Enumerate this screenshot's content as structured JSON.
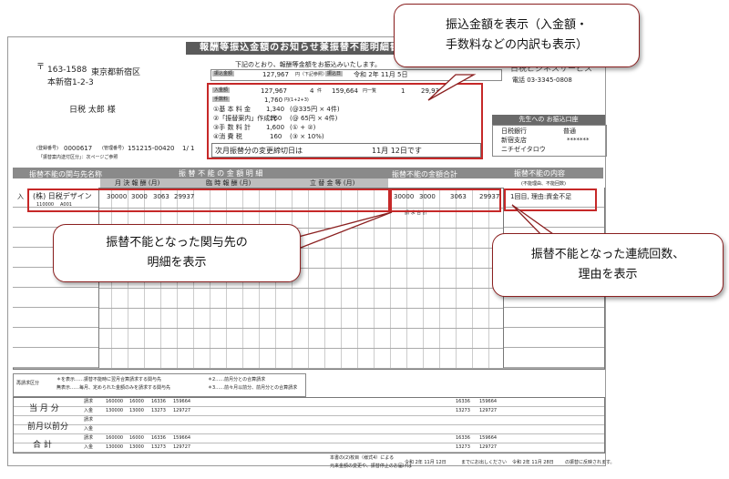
{
  "header": {
    "title": "報酬等振込金額のお知らせ兼振替不能明細書",
    "notice": "下記のとおり、報酬等金額をお振込みいたします。",
    "postal": "〒",
    "zip": "163-1588",
    "address1": "東京都新宿区",
    "address2": "本新宿1-2-3",
    "recipient": "日税 太郎 様",
    "sender": "日税ビジネスサービス",
    "phone": "電話 03-3345-0808"
  },
  "amounts": {
    "transfer_label": "振込金額",
    "transfer_value": "127,967",
    "transfer_unit": "円（下記参照）",
    "date_label": "振込日",
    "date_value": "令和 2年 11月 5日",
    "deposit_label": "入金額",
    "deposit_value": "127,967",
    "deposit_count": "4",
    "deposit_count_unit": "件",
    "deposit_total": "159,664",
    "deposit_total_unit": "円一覧",
    "fail_count": "1",
    "fail_amount": "29,937",
    "fee_label": "手数料",
    "fee_value": "1,760",
    "fee_formula": "円(1+2+3)",
    "basic_label": "①基 本 料 金",
    "basic_value": "1,340",
    "basic_note": "(@335円 × 4件)",
    "detail_label": "②「振替案内」作成代",
    "detail_value": "260",
    "detail_note": "(@ 65円 × 4件)",
    "proc_label": "③手 数 料 計",
    "proc_value": "1,600",
    "proc_note": "(① + ②)",
    "tax_label": "④消 費 税",
    "tax_value": "160",
    "tax_note": "(③ × 10%)",
    "next_label": "次月振替分の変更締切日は",
    "next_date": "11月 12日です"
  },
  "bank": {
    "title": "先生への お振込口座",
    "bank_name": "日税銀行",
    "branch_name": "新宿支店",
    "account_type": "普通",
    "account_no": "*******",
    "holder": "ニチゼイタロウ"
  },
  "record": {
    "label": "(登録番号)",
    "number": "0000617",
    "manage_label": "(管理番号)",
    "manage_number": "151215-00420",
    "page": "1/ 1",
    "guide": "「振替案内送付区分」：次ページご参照"
  },
  "table": {
    "section_left": "振替不能の関与先名称",
    "section_mid": "振 替 不 能 の 金 額 明 細",
    "section_total": "振替不能の金額合計",
    "section_reason": "振替不能の内容",
    "reason_sub": "(不能理由、不能回数)",
    "col_monthly": "月 決 報 酬 (月)",
    "col_temp": "臨 時 報 酬 (月)",
    "col_advance": "立 替 金 等 (月)",
    "row_mark": "入",
    "row_name": "(株) 日税デザイン",
    "row_code": "110000",
    "row_code2": "A001",
    "row_values": [
      "30000",
      "3000",
      "3063",
      "29937"
    ],
    "row_totals": [
      "30000",
      "3000",
      "3063",
      "29937"
    ],
    "row_reason": "1回目, 理由:資金不足",
    "billing_label": "請 求 合 計"
  },
  "summary": {
    "legend_title": "再請求区分",
    "legend1": "＊を表示……振替不能時に翌月合算請求する関与先",
    "legend2": "無表示……毎月、定められた金額のみを請求する関与先",
    "legend3": "＊2……前月分との合算請求",
    "legend4": "＊3……前々月以前分、前月分との合算請求",
    "current": "当 月 分",
    "previous": "前月以前分",
    "total": "合 計",
    "bill": "請求",
    "deposit": "入金",
    "cur_bill": [
      "160000",
      "16000",
      "16336",
      "159664",
      "16336",
      "159664"
    ],
    "cur_dep": [
      "130000",
      "13000",
      "13273",
      "129727",
      "13273",
      "129727"
    ],
    "tot_bill": [
      "160000",
      "16000",
      "16336",
      "159664",
      "16336",
      "159664"
    ],
    "tot_dep": [
      "130000",
      "13000",
      "13273",
      "129727",
      "13273",
      "129727"
    ],
    "footer_note1": "本書の(2)枚目（様式4）による",
    "footer_note2": "元来金額の変更や、振替停止のお届けは",
    "footer_date1": "令和 2年 11月 12日",
    "footer_note3": "までにお出しください",
    "footer_date2": "令和 2年 11月 28日",
    "footer_note4": "の振替に反映されます。"
  },
  "callouts": {
    "c1_line1": "振込金額を表示（入金額・",
    "c1_line2": "手数料などの内訳も表示）",
    "c2_line1": "振替不能となった関与先の",
    "c2_line2": "明細を表示",
    "c3_line1": "振替不能となった連続回数、",
    "c3_line2": "理由を表示"
  }
}
